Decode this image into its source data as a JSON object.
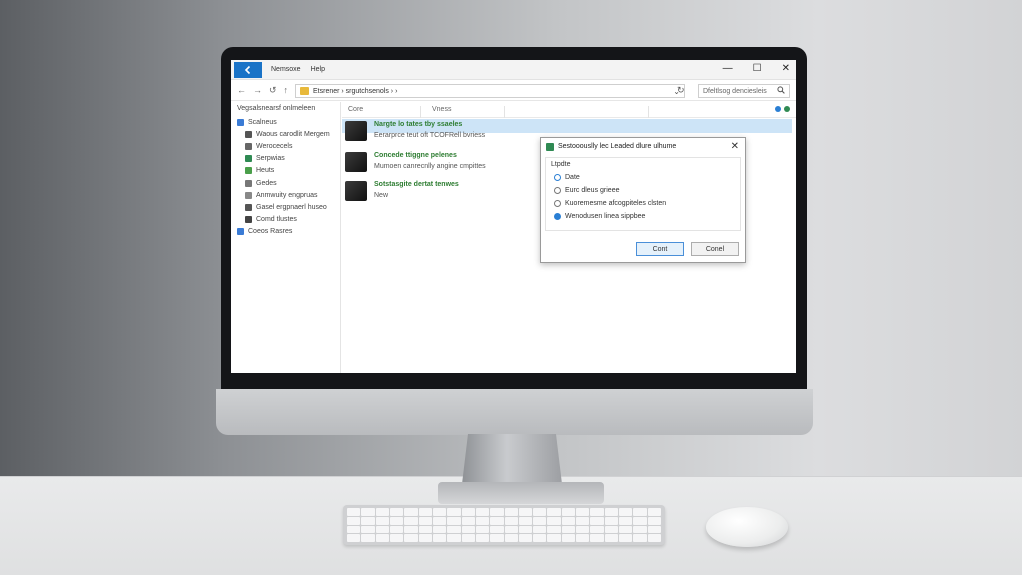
{
  "colors": {
    "accent": "#1a73c7",
    "selection": "#cde4f7",
    "item_title": "#2e7d32",
    "folder": "#e8b93b"
  },
  "titlebar": {
    "back_icon": "arrow-left-icon",
    "menu": [
      "Nemsoxe",
      "Help"
    ],
    "minimize": "—",
    "maximize": "☐",
    "close": "✕"
  },
  "addressbar": {
    "back": "←",
    "forward": "→",
    "recent": "↺",
    "up": "↑",
    "path": "Etsrener › srgutchsenols › ›",
    "dropdown": "⌄",
    "refresh": "↻",
    "search_placeholder": "Dfeltlsog denciesleis",
    "search_icon": "search-icon"
  },
  "sidebar": {
    "header": "Vegsalsnearsf onlmeleen",
    "items": [
      {
        "label": "Scalneus",
        "color": "#3a7bd5"
      },
      {
        "label": "Waous carodlit Mergem",
        "color": "#555555"
      },
      {
        "label": "Werocecels",
        "color": "#666666"
      },
      {
        "label": "Serpwias",
        "color": "#2f8a53"
      },
      {
        "label": "Heuts",
        "color": "#4a9f4a"
      },
      {
        "label": "Gedes",
        "color": "#777777"
      },
      {
        "label": "Anmwuity engpruas",
        "color": "#888888"
      },
      {
        "label": "Gasel ergpnaerl huseo",
        "color": "#555555"
      },
      {
        "label": "Comd tlustes",
        "color": "#444444"
      },
      {
        "label": "Coeos Rasres",
        "color": "#3a7bd5"
      }
    ]
  },
  "columns": [
    "Core",
    "Vness"
  ],
  "files": [
    {
      "title": "Nargte lo tates tby ssaeles",
      "subtitle": "Eerarprce teut oft TCOFRell bvriess"
    },
    {
      "title": "Concede ttiggne pelenes",
      "subtitle": "Mumoen canrecnlly angine cmpittes"
    },
    {
      "title": "Sotstasgite dertat tenwes",
      "subtitle": "New"
    }
  ],
  "dialog": {
    "title": "Sestooouslly lec Leaded dlure ulhume",
    "close": "✕",
    "legend": "Ltpdte",
    "options": [
      {
        "label": "Date",
        "state": "half"
      },
      {
        "label": "Eurc dleus grieee",
        "state": "off"
      },
      {
        "label": "Kuoremesme afcogpiteles clsten",
        "state": "off"
      },
      {
        "label": "Wenodusen linea sippbee",
        "state": "on"
      }
    ],
    "ok_label": "Cont",
    "cancel_label": "Conel"
  }
}
